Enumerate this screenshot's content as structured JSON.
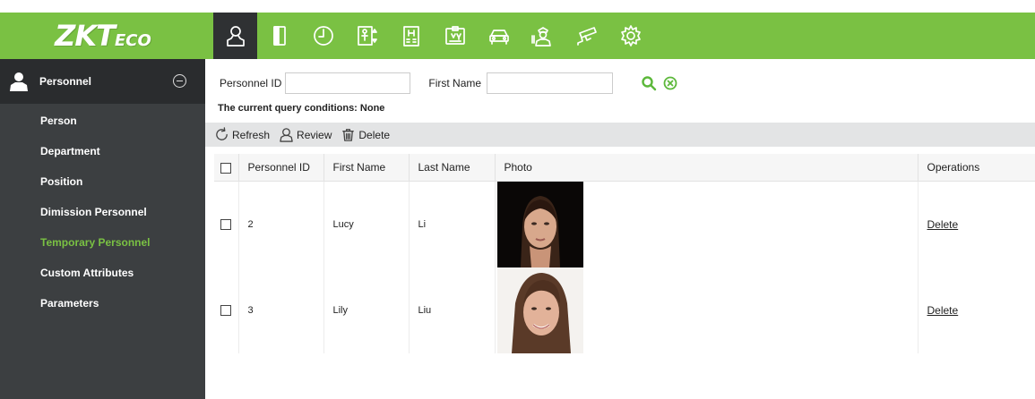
{
  "brand": {
    "logo_main": "ZKT",
    "logo_tail": "ECO"
  },
  "modules": [
    {
      "icon": "personnel-icon",
      "active": true
    },
    {
      "icon": "access-door-icon",
      "active": false
    },
    {
      "icon": "attendance-clock-icon",
      "active": false
    },
    {
      "icon": "elevator-icon",
      "active": false
    },
    {
      "icon": "hotel-icon",
      "active": false
    },
    {
      "icon": "visitor-card-icon",
      "active": false
    },
    {
      "icon": "parking-car-icon",
      "active": false
    },
    {
      "icon": "patrol-guard-icon",
      "active": false
    },
    {
      "icon": "video-camera-icon",
      "active": false
    },
    {
      "icon": "system-gear-icon",
      "active": false
    }
  ],
  "sidebar": {
    "title": "Personnel",
    "items": [
      {
        "label": "Person",
        "active": false
      },
      {
        "label": "Department",
        "active": false
      },
      {
        "label": "Position",
        "active": false
      },
      {
        "label": "Dimission Personnel",
        "active": false
      },
      {
        "label": "Temporary Personnel",
        "active": true
      },
      {
        "label": "Custom Attributes",
        "active": false
      },
      {
        "label": "Parameters",
        "active": false
      }
    ]
  },
  "query": {
    "personnel_id_label": "Personnel ID",
    "personnel_id_value": "",
    "first_name_label": "First Name",
    "first_name_value": "",
    "conditions_label": "The current query conditions:",
    "conditions_value": "None"
  },
  "toolbar": {
    "refresh": "Refresh",
    "review": "Review",
    "delete": "Delete"
  },
  "table": {
    "columns": [
      "Personnel ID",
      "First Name",
      "Last Name",
      "Photo",
      "Operations"
    ],
    "rows": [
      {
        "id": "2",
        "first_name": "Lucy",
        "last_name": "Li",
        "operation": "Delete"
      },
      {
        "id": "3",
        "first_name": "Lily",
        "last_name": "Liu",
        "operation": "Delete"
      }
    ]
  },
  "colors": {
    "accent": "#7ac143",
    "sidebar_bg": "#3c3f41",
    "active_module_bg": "#2f3133"
  }
}
